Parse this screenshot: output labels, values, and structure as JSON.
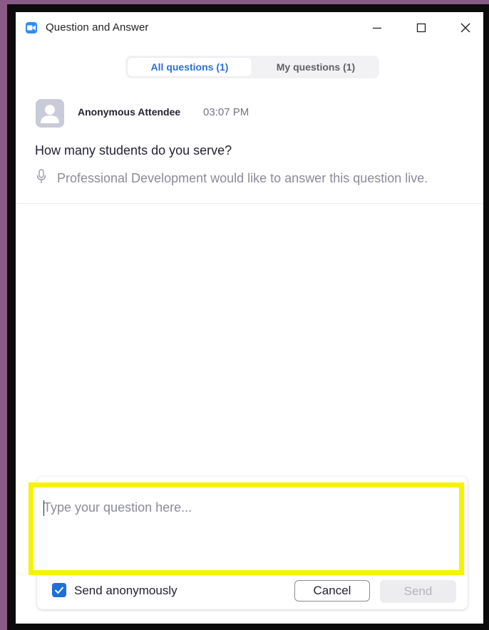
{
  "window": {
    "title": "Question and Answer",
    "icons": {
      "app": "zoom-camera-icon",
      "minimize": "minimize-icon",
      "maximize": "maximize-icon",
      "close": "close-icon"
    }
  },
  "tabs": [
    {
      "label": "All questions (1)",
      "selected": true
    },
    {
      "label": "My questions (1)",
      "selected": false
    }
  ],
  "questions": [
    {
      "author": "Anonymous Attendee",
      "time": "03:07 PM",
      "text": "How many students do you serve?",
      "status_icon": "microphone-icon",
      "status": "Professional Development would like to answer this question live."
    }
  ],
  "composer": {
    "placeholder": "Type your question here...",
    "value": "",
    "send_anonymously_label": "Send anonymously",
    "send_anonymously_checked": true,
    "cancel_label": "Cancel",
    "send_label": "Send",
    "send_enabled": false
  },
  "colors": {
    "accent": "#2d6fdc",
    "highlight": "#f7f300",
    "background": "#8a5a86"
  }
}
